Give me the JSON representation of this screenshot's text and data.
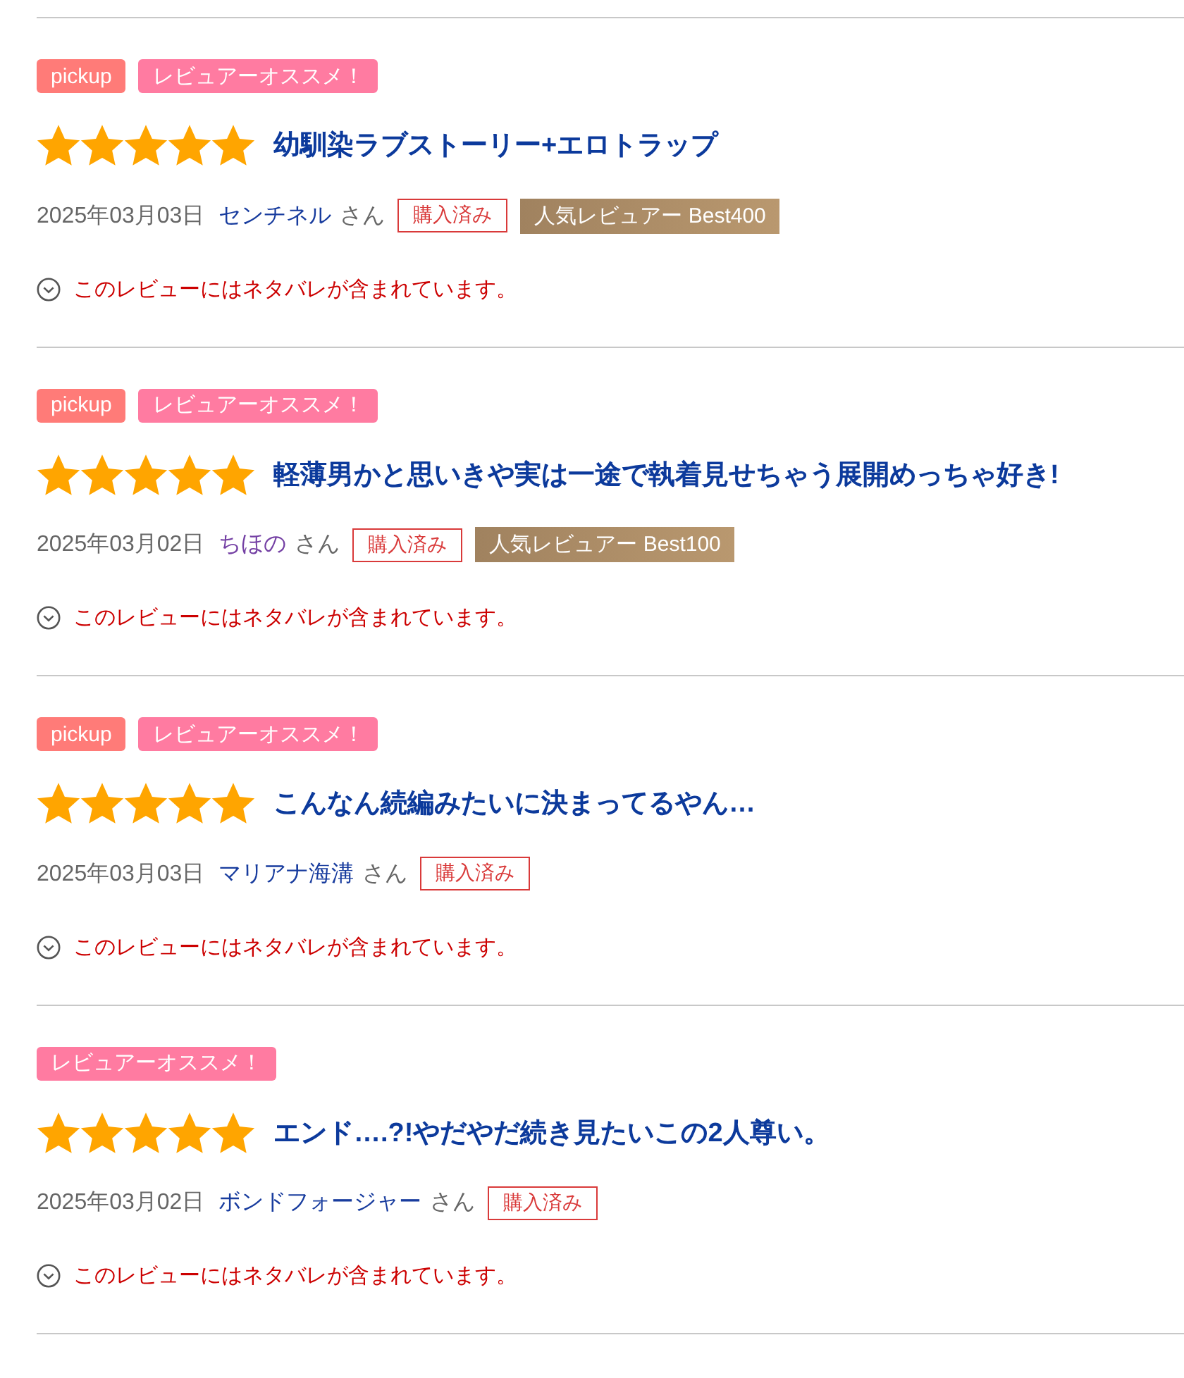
{
  "reviews": [
    {
      "tags": [
        {
          "kind": "pickup",
          "label": "pickup"
        },
        {
          "kind": "recommend",
          "label": "レビュアーオススメ！"
        }
      ],
      "stars": 5,
      "title": "幼馴染ラブストーリー+エロトラップ",
      "date": "2025年03月03日",
      "reviewer": {
        "name": "センチネル",
        "visited": false
      },
      "honorific": "さん",
      "purchased": "購入済み",
      "rank": "人気レビュアー Best400",
      "spoiler": "このレビューにはネタバレが含まれています。"
    },
    {
      "tags": [
        {
          "kind": "pickup",
          "label": "pickup"
        },
        {
          "kind": "recommend",
          "label": "レビュアーオススメ！"
        }
      ],
      "stars": 5,
      "title": "軽薄男かと思いきや実は一途で執着見せちゃう展開めっちゃ好き!",
      "date": "2025年03月02日",
      "reviewer": {
        "name": "ちほの",
        "visited": true
      },
      "honorific": "さん",
      "purchased": "購入済み",
      "rank": "人気レビュアー Best100",
      "spoiler": "このレビューにはネタバレが含まれています。"
    },
    {
      "tags": [
        {
          "kind": "pickup",
          "label": "pickup"
        },
        {
          "kind": "recommend",
          "label": "レビュアーオススメ！"
        }
      ],
      "stars": 5,
      "title": "こんなん続編みたいに決まってるやん…",
      "date": "2025年03月03日",
      "reviewer": {
        "name": "マリアナ海溝",
        "visited": false
      },
      "honorific": "さん",
      "purchased": "購入済み",
      "spoiler": "このレビューにはネタバレが含まれています。"
    },
    {
      "tags": [
        {
          "kind": "recommend",
          "label": "レビュアーオススメ！"
        }
      ],
      "stars": 5,
      "title": "エンド….?!やだやだ続き見たいこの2人尊い。",
      "date": "2025年03月02日",
      "reviewer": {
        "name": "ボンドフォージャー",
        "visited": false
      },
      "honorific": "さん",
      "purchased": "購入済み",
      "spoiler": "このレビューにはネタバレが含まれています。"
    }
  ]
}
